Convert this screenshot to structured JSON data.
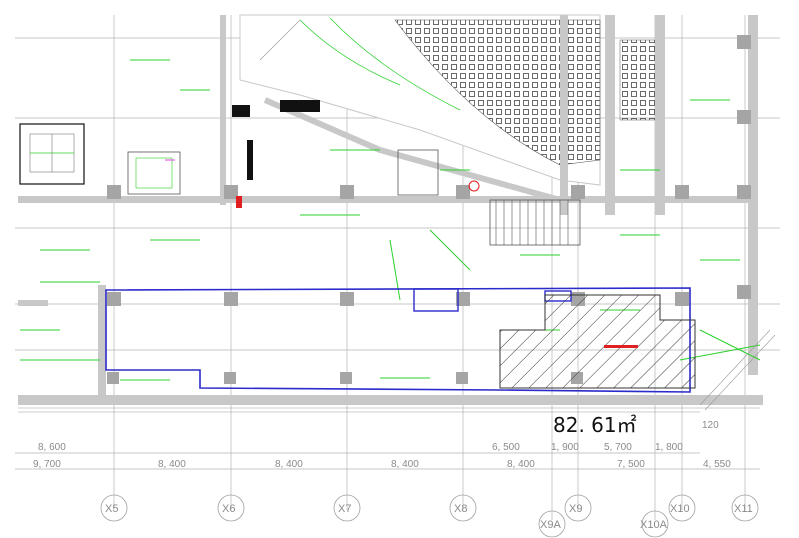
{
  "drawing": {
    "area_label": "82. 61㎡",
    "highlight_tag": "",
    "colors": {
      "background": "#ffffff",
      "wall": "#c8c8c8",
      "grid": "#b5b5b5",
      "annotation": "#2bd12b",
      "outline": "#2b2bcc",
      "hatch": "#333333",
      "marker": "#e02020"
    }
  },
  "dimensions": {
    "upper_row": [
      "8, 600",
      "6, 500",
      "1, 900",
      "5, 700",
      "1, 800"
    ],
    "lower_row": [
      "9, 700",
      "8, 400",
      "8, 400",
      "8, 400",
      "8, 400",
      "7, 500",
      "4, 550"
    ],
    "small_note": "120"
  },
  "axes": {
    "primary": [
      "X5",
      "X6",
      "X7",
      "X8",
      "X9",
      "X10",
      "X11"
    ],
    "secondary": [
      "X9A",
      "X10A"
    ]
  }
}
